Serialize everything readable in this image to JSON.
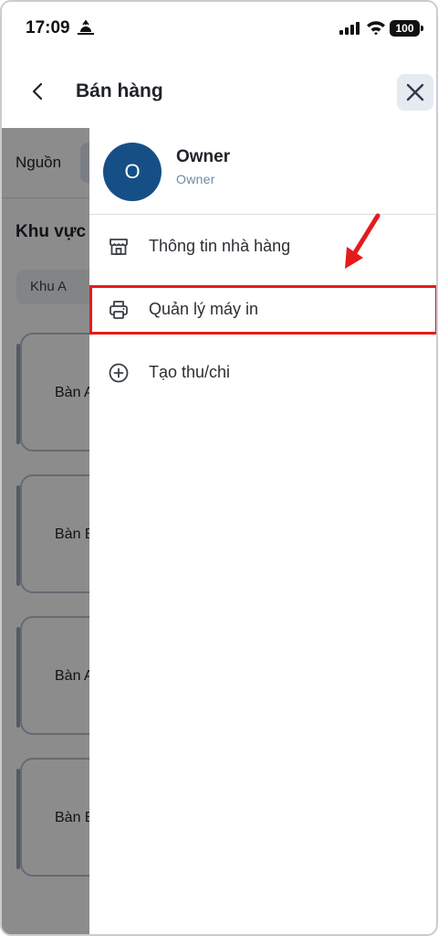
{
  "status_bar": {
    "time": "17:09",
    "battery": "100",
    "icons": [
      "sun-icon",
      "signal-icon",
      "wifi-icon",
      "battery-icon"
    ]
  },
  "header": {
    "title": "Bán hàng",
    "back_icon": "chevron-left-icon",
    "close_icon": "close-icon"
  },
  "background": {
    "source_label": "Nguồn",
    "area_title": "Khu vực",
    "area_chip": "Khu A",
    "tables": [
      "Bàn A",
      "Bàn B",
      "Bàn A",
      "Bàn B"
    ]
  },
  "drawer": {
    "avatar_initial": "O",
    "user_name": "Owner",
    "user_role": "Owner",
    "menu_items": [
      {
        "label": "Thông tin nhà hàng",
        "icon": "store-icon"
      },
      {
        "label": "Quản lý máy in",
        "icon": "printer-icon"
      },
      {
        "label": "Tạo thu/chi",
        "icon": "plus-circle-icon"
      }
    ]
  },
  "colors": {
    "avatar_bg": "#164f86",
    "highlight_border": "#e41b1b",
    "annotation_arrow": "#e41b1b"
  }
}
